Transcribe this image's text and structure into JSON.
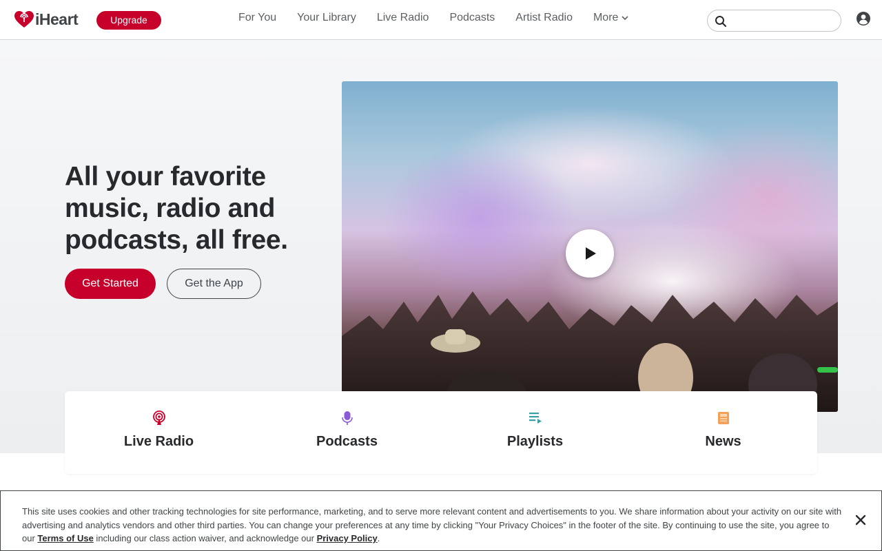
{
  "header": {
    "logo_text": "iHeart",
    "upgrade_label": "Upgrade",
    "nav": [
      {
        "label": "For You"
      },
      {
        "label": "Your Library"
      },
      {
        "label": "Live Radio"
      },
      {
        "label": "Podcasts"
      },
      {
        "label": "Artist Radio"
      },
      {
        "label": "More"
      }
    ],
    "search_placeholder": "",
    "icons": {
      "search": "search-icon",
      "account": "account-icon",
      "more": "chevron-down-icon"
    }
  },
  "hero": {
    "title": "All your favorite music, radio and podcasts, all free.",
    "primary_cta": "Get Started",
    "secondary_cta": "Get the App",
    "media": {
      "play_icon": "play-icon"
    }
  },
  "categories": [
    {
      "label": "Live Radio",
      "icon": "radio-broadcast-icon",
      "color": "#c6002b"
    },
    {
      "label": "Podcasts",
      "icon": "microphone-icon",
      "color": "#8a5ad9"
    },
    {
      "label": "Playlists",
      "icon": "playlist-icon",
      "color": "#3a9ea5"
    },
    {
      "label": "News",
      "icon": "newspaper-icon",
      "color": "#f0a25a"
    }
  ],
  "cookie_banner": {
    "text_part1": "This site uses cookies and other tracking technologies for site performance, marketing, and to serve more relevant content and advertisements to you. We share information about your activity on our site with advertising and analytics vendors and other third parties. You can change your preferences at any time by clicking \"Your Privacy Choices\" in the footer of the site. By continuing to use the site, you agree to our ",
    "terms_link": "Terms of Use",
    "text_part2": " including our class action waiver, and acknowledge our ",
    "privacy_link": "Privacy Policy",
    "text_part3": ".",
    "close_icon": "close-icon"
  },
  "colors": {
    "brand_red": "#c6002b",
    "text_dark": "#27292d",
    "text_nav": "#5c6064"
  }
}
